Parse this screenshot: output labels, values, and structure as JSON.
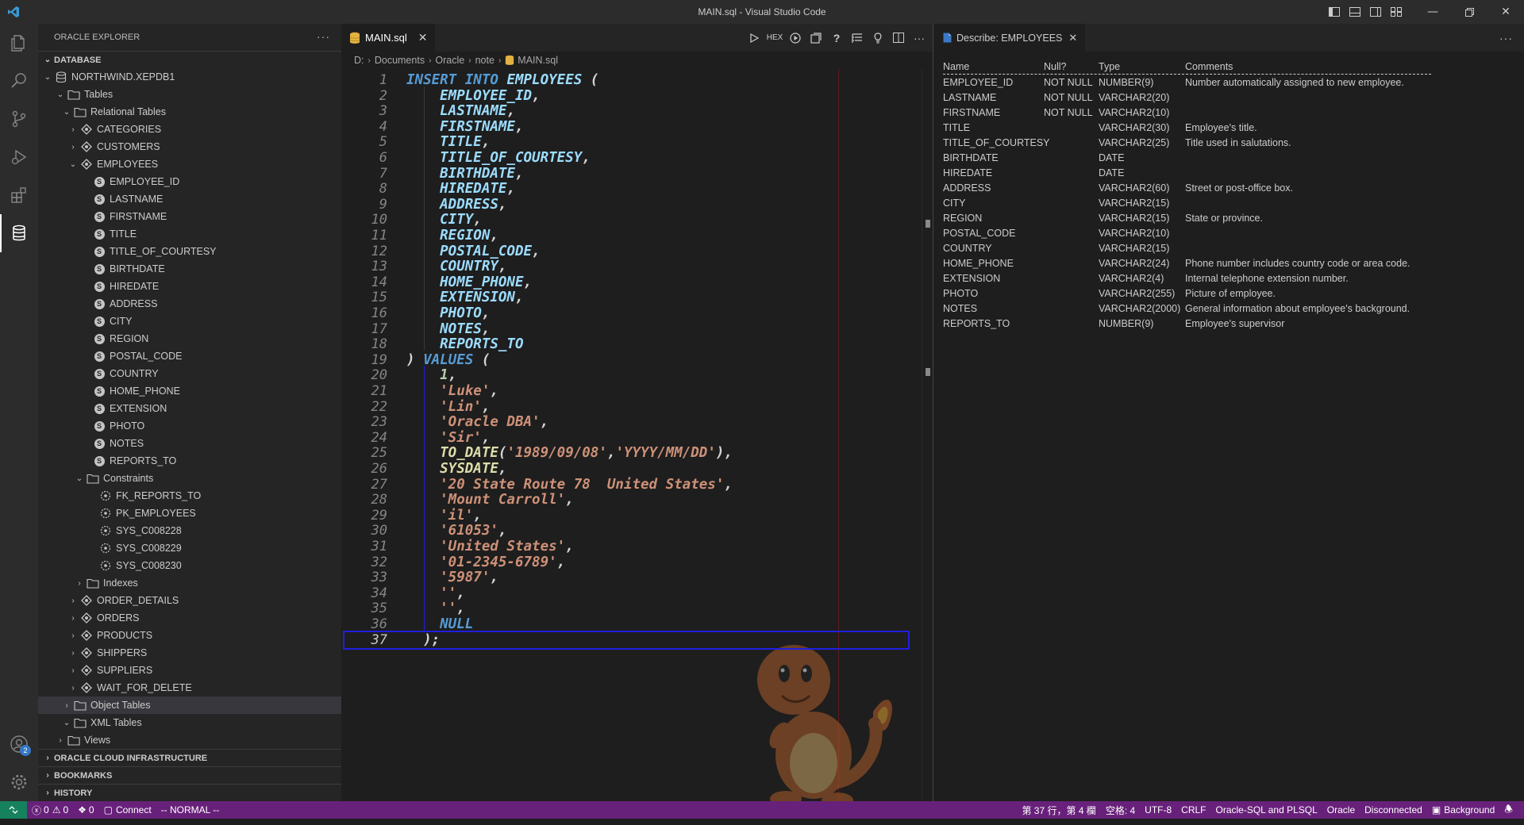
{
  "window": {
    "title": "MAIN.sql - Visual Studio Code"
  },
  "sidebar": {
    "title": "ORACLE EXPLORER",
    "sections": {
      "database": "DATABASE",
      "oci": "ORACLE CLOUD INFRASTRUCTURE",
      "bookmarks": "BOOKMARKS",
      "history": "HISTORY"
    },
    "connection": "NORTHWIND.XEPDB1",
    "tables": "Tables",
    "relational": "Relational Tables",
    "categories": "CATEGORIES",
    "customers": "CUSTOMERS",
    "employees": "EMPLOYEES",
    "columns": [
      "EMPLOYEE_ID",
      "LASTNAME",
      "FIRSTNAME",
      "TITLE",
      "TITLE_OF_COURTESY",
      "BIRTHDATE",
      "HIREDATE",
      "ADDRESS",
      "CITY",
      "REGION",
      "POSTAL_CODE",
      "COUNTRY",
      "HOME_PHONE",
      "EXTENSION",
      "PHOTO",
      "NOTES",
      "REPORTS_TO"
    ],
    "constraints": "Constraints",
    "constraint_items": [
      "FK_REPORTS_TO",
      "PK_EMPLOYEES",
      "SYS_C008228",
      "SYS_C008229",
      "SYS_C008230"
    ],
    "indexes": "Indexes",
    "more_tables": [
      "ORDER_DETAILS",
      "ORDERS",
      "PRODUCTS",
      "SHIPPERS",
      "SUPPLIERS",
      "WAIT_FOR_DELETE"
    ],
    "object_tables": "Object Tables",
    "xml_tables": "XML Tables",
    "views": "Views"
  },
  "editor": {
    "tab": "MAIN.sql",
    "breadcrumbs": [
      "D:",
      "Documents",
      "Oracle",
      "note",
      "MAIN.sql"
    ],
    "hex_label": "HEX",
    "lines": [
      [
        [
          "kw",
          "INSERT INTO "
        ],
        [
          "id",
          "EMPLOYEES"
        ],
        [
          "pun",
          " ("
        ]
      ],
      [
        [
          "id",
          "    EMPLOYEE_ID"
        ],
        [
          "pun",
          ","
        ]
      ],
      [
        [
          "id",
          "    LASTNAME"
        ],
        [
          "pun",
          ","
        ]
      ],
      [
        [
          "id",
          "    FIRSTNAME"
        ],
        [
          "pun",
          ","
        ]
      ],
      [
        [
          "id",
          "    TITLE"
        ],
        [
          "pun",
          ","
        ]
      ],
      [
        [
          "id",
          "    TITLE_OF_COURTESY"
        ],
        [
          "pun",
          ","
        ]
      ],
      [
        [
          "id",
          "    BIRTHDATE"
        ],
        [
          "pun",
          ","
        ]
      ],
      [
        [
          "id",
          "    HIREDATE"
        ],
        [
          "pun",
          ","
        ]
      ],
      [
        [
          "id",
          "    ADDRESS"
        ],
        [
          "pun",
          ","
        ]
      ],
      [
        [
          "id",
          "    CITY"
        ],
        [
          "pun",
          ","
        ]
      ],
      [
        [
          "id",
          "    REGION"
        ],
        [
          "pun",
          ","
        ]
      ],
      [
        [
          "id",
          "    POSTAL_CODE"
        ],
        [
          "pun",
          ","
        ]
      ],
      [
        [
          "id",
          "    COUNTRY"
        ],
        [
          "pun",
          ","
        ]
      ],
      [
        [
          "id",
          "    HOME_PHONE"
        ],
        [
          "pun",
          ","
        ]
      ],
      [
        [
          "id",
          "    EXTENSION"
        ],
        [
          "pun",
          ","
        ]
      ],
      [
        [
          "id",
          "    PHOTO"
        ],
        [
          "pun",
          ","
        ]
      ],
      [
        [
          "id",
          "    NOTES"
        ],
        [
          "pun",
          ","
        ]
      ],
      [
        [
          "id",
          "    REPORTS_TO"
        ]
      ],
      [
        [
          "pun",
          ") "
        ],
        [
          "kw",
          "VALUES"
        ],
        [
          "pun",
          " ("
        ]
      ],
      [
        [
          "num",
          "    1"
        ],
        [
          "pun",
          ","
        ]
      ],
      [
        [
          "str",
          "    'Luke'"
        ],
        [
          "pun",
          ","
        ]
      ],
      [
        [
          "str",
          "    'Lin'"
        ],
        [
          "pun",
          ","
        ]
      ],
      [
        [
          "str",
          "    'Oracle DBA'"
        ],
        [
          "pun",
          ","
        ]
      ],
      [
        [
          "str",
          "    'Sir'"
        ],
        [
          "pun",
          ","
        ]
      ],
      [
        [
          "fn",
          "    TO_DATE"
        ],
        [
          "pun",
          "("
        ],
        [
          "str",
          "'1989/09/08'"
        ],
        [
          "pun",
          ","
        ],
        [
          "str",
          "'YYYY/MM/DD'"
        ],
        [
          "pun",
          "),"
        ]
      ],
      [
        [
          "fn",
          "    SYSDATE"
        ],
        [
          "pun",
          ","
        ]
      ],
      [
        [
          "str",
          "    '20 State Route 78  United States'"
        ],
        [
          "pun",
          ","
        ]
      ],
      [
        [
          "str",
          "    'Mount Carroll'"
        ],
        [
          "pun",
          ","
        ]
      ],
      [
        [
          "str",
          "    'il'"
        ],
        [
          "pun",
          ","
        ]
      ],
      [
        [
          "str",
          "    '61053'"
        ],
        [
          "pun",
          ","
        ]
      ],
      [
        [
          "str",
          "    'United States'"
        ],
        [
          "pun",
          ","
        ]
      ],
      [
        [
          "str",
          "    '01-2345-6789'"
        ],
        [
          "pun",
          ","
        ]
      ],
      [
        [
          "str",
          "    '5987'"
        ],
        [
          "pun",
          ","
        ]
      ],
      [
        [
          "str",
          "    ''"
        ],
        [
          "pun",
          ","
        ]
      ],
      [
        [
          "str",
          "    ''"
        ],
        [
          "pun",
          ","
        ]
      ],
      [
        [
          "nul",
          "    NULL"
        ]
      ],
      [
        [
          "pun",
          "  );"
        ]
      ]
    ],
    "current_line": 37
  },
  "describe": {
    "tab": "Describe: EMPLOYEES",
    "headers": [
      "Name",
      "Null?",
      "Type",
      "Comments"
    ],
    "rows": [
      [
        "EMPLOYEE_ID",
        "NOT NULL",
        "NUMBER(9)",
        "Number automatically assigned to new employee."
      ],
      [
        "LASTNAME",
        "NOT NULL",
        "VARCHAR2(20)",
        ""
      ],
      [
        "FIRSTNAME",
        "NOT NULL",
        "VARCHAR2(10)",
        ""
      ],
      [
        "TITLE",
        "",
        "VARCHAR2(30)",
        "Employee's title."
      ],
      [
        "TITLE_OF_COURTESY",
        "",
        "VARCHAR2(25)",
        "Title used in salutations."
      ],
      [
        "BIRTHDATE",
        "",
        "DATE",
        ""
      ],
      [
        "HIREDATE",
        "",
        "DATE",
        ""
      ],
      [
        "ADDRESS",
        "",
        "VARCHAR2(60)",
        "Street or post-office box."
      ],
      [
        "CITY",
        "",
        "VARCHAR2(15)",
        ""
      ],
      [
        "REGION",
        "",
        "VARCHAR2(15)",
        "State or province."
      ],
      [
        "POSTAL_CODE",
        "",
        "VARCHAR2(10)",
        ""
      ],
      [
        "COUNTRY",
        "",
        "VARCHAR2(15)",
        ""
      ],
      [
        "HOME_PHONE",
        "",
        "VARCHAR2(24)",
        "Phone number includes country code or area code."
      ],
      [
        "EXTENSION",
        "",
        "VARCHAR2(4)",
        "Internal telephone extension number."
      ],
      [
        "PHOTO",
        "",
        "VARCHAR2(255)",
        "Picture of employee."
      ],
      [
        "NOTES",
        "",
        "VARCHAR2(2000)",
        "General information about employee's background."
      ],
      [
        "REPORTS_TO",
        "",
        "NUMBER(9)",
        "Employee's supervisor"
      ]
    ]
  },
  "status": {
    "errors": "0",
    "warnings": "0",
    "ports": "0",
    "connect": "Connect",
    "mode": "-- NORMAL --",
    "position": "第 37 行，第 4 欄",
    "spaces": "空格: 4",
    "encoding": "UTF-8",
    "eol": "CRLF",
    "language": "Oracle-SQL and PLSQL",
    "oracle": "Oracle",
    "disconnected": "Disconnected",
    "background": "Background"
  },
  "colors": {
    "status_bar": "#68217a",
    "remote": "#16825d",
    "accent": "#569cd6"
  },
  "activity_badge": "2"
}
